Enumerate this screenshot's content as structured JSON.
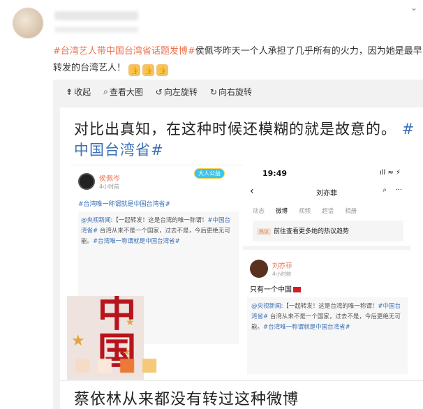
{
  "post": {
    "hashtag": "#台湾艺人带中国台湾省话题发博#",
    "text": "侯佩岑昨天一个人承担了几乎所有的火力，因为她是最早转发的台湾艺人！",
    "thumbs": [
      "👍",
      "👍",
      "👍"
    ]
  },
  "toolbar": {
    "collapse": "收起",
    "view_large": "查看大图",
    "rotate_left": "向左旋转",
    "rotate_right": "向右旋转"
  },
  "image": {
    "headline_text": "对比出真知，在这种时候还模糊的就是故意的。",
    "headline_tag": "#中国台湾省#",
    "left_post": {
      "name": "侯佩岑",
      "time": "4小时前",
      "badge": "大人公益",
      "text": "#台湾唯一称谓就是中国台湾省#",
      "repost_source": "@央视新闻",
      "repost_text": ":【一起转发！这是台湾的唯一称谓！",
      "repost_tag1": "#中国台湾省#",
      "repost_body": " 台湾从来不是一个国家，过去不是，今后更绝无可能。",
      "repost_tag2": "#台湾唯一称谓就是中国台湾省#",
      "poster_char": "中国"
    },
    "phone": {
      "time": "19:49",
      "icons": "ıll ≈ ⚡",
      "title": "刘亦菲",
      "tabs": [
        "动态",
        "微博",
        "视频",
        "超话",
        "相册"
      ],
      "trend_tag": "热议",
      "trend_text": "前往查看更多她的热议趋势",
      "name": "刘亦菲",
      "post_time": "4小时前",
      "post_text": "只有一个中国",
      "repost_source": "@央视新闻",
      "repost_text": ":【一起转发！这是台湾的唯一称谓！",
      "repost_tag1": "#中国台湾省#",
      "repost_body": " 台湾从来不是一个国家，过去不是，今后更绝无可能。",
      "repost_tag2": "#台湾唯一称谓就是中国台湾省#"
    },
    "bottom_text": "蔡依林从来都没有转过这种微博"
  },
  "colors": {
    "link_orange": "#eb7350",
    "tag_blue": "#3b6fb6",
    "viewer_bg": "#f2f2f2"
  }
}
